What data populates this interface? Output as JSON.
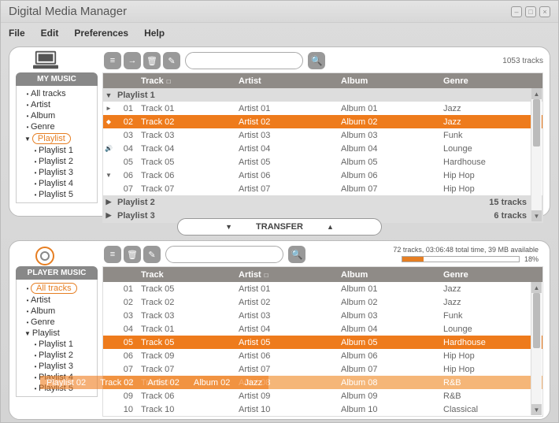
{
  "window": {
    "title": "Digital Media Manager"
  },
  "menu": {
    "file": "File",
    "edit": "Edit",
    "preferences": "Preferences",
    "help": "Help"
  },
  "top_panel": {
    "sidebar_title": "MY MUSIC",
    "track_count": "1053 tracks",
    "sidebar": [
      {
        "label": "All tracks",
        "indent": false,
        "bullet": "•"
      },
      {
        "label": "Artist",
        "indent": false,
        "bullet": "•"
      },
      {
        "label": "Album",
        "indent": false,
        "bullet": "•"
      },
      {
        "label": "Genre",
        "indent": false,
        "bullet": "•"
      },
      {
        "label": "Playlist",
        "indent": false,
        "bullet": "▼",
        "selected": true
      },
      {
        "label": "Playlist 1",
        "indent": true,
        "bullet": "•"
      },
      {
        "label": "Playlist 2",
        "indent": true,
        "bullet": "•"
      },
      {
        "label": "Playlist 3",
        "indent": true,
        "bullet": "•"
      },
      {
        "label": "Playlist 4",
        "indent": true,
        "bullet": "•"
      },
      {
        "label": "Playlist 5",
        "indent": true,
        "bullet": "•"
      }
    ],
    "columns": {
      "track": "Track",
      "artist": "Artist",
      "album": "Album",
      "genre": "Genre"
    },
    "groups": [
      {
        "label": "Playlist 1",
        "expanded": true,
        "rows": [
          {
            "num": "01",
            "play": "►",
            "track": "Track 01",
            "artist": "Artist 01",
            "album": "Album 01",
            "genre": "Jazz"
          },
          {
            "num": "02",
            "play": "◆",
            "track": "Track 02",
            "artist": "Artist 02",
            "album": "Album 02",
            "genre": "Jazz",
            "selected": true
          },
          {
            "num": "03",
            "play": "",
            "track": "Track 03",
            "artist": "Artist 03",
            "album": "Album 03",
            "genre": "Funk"
          },
          {
            "num": "04",
            "play": "🔊",
            "track": "Track 04",
            "artist": "Artist 04",
            "album": "Album 04",
            "genre": "Lounge"
          },
          {
            "num": "05",
            "play": "",
            "track": "Track 05",
            "artist": "Artist 05",
            "album": "Album 05",
            "genre": "Hardhouse"
          },
          {
            "num": "06",
            "play": "▼",
            "track": "Track 06",
            "artist": "Artist 06",
            "album": "Album 06",
            "genre": "Hip Hop"
          },
          {
            "num": "07",
            "play": "",
            "track": "Track 07",
            "artist": "Artist 07",
            "album": "Album 07",
            "genre": "Hip Hop"
          }
        ]
      },
      {
        "label": "Playlist 2",
        "expanded": false,
        "info": "15 tracks"
      },
      {
        "label": "Playlist 3",
        "expanded": false,
        "info": "6 tracks"
      }
    ]
  },
  "transfer": {
    "label": "TRANSFER"
  },
  "bottom_panel": {
    "sidebar_title": "PLAYER MUSIC",
    "status": "72 tracks, 03:06:48 total time, 39 MB available",
    "progress_pct": "18%",
    "progress_value": 18,
    "sidebar": [
      {
        "label": "All tracks",
        "indent": false,
        "bullet": "•",
        "selected": true
      },
      {
        "label": "Artist",
        "indent": false,
        "bullet": "•"
      },
      {
        "label": "Album",
        "indent": false,
        "bullet": "•"
      },
      {
        "label": "Genre",
        "indent": false,
        "bullet": "•"
      },
      {
        "label": "Playlist",
        "indent": false,
        "bullet": "▼"
      },
      {
        "label": "Playlist 1",
        "indent": true,
        "bullet": "•"
      },
      {
        "label": "Playlist 2",
        "indent": true,
        "bullet": "•"
      },
      {
        "label": "Playlist 3",
        "indent": true,
        "bullet": "•"
      },
      {
        "label": "Playlist 4",
        "indent": true,
        "bullet": "•"
      },
      {
        "label": "Playlist 5",
        "indent": true,
        "bullet": "•"
      }
    ],
    "columns": {
      "track": "Track",
      "artist": "Artist",
      "album": "Album",
      "genre": "Genre"
    },
    "rows": [
      {
        "num": "01",
        "track": "Track 05",
        "artist": "Artist 01",
        "album": "Album 01",
        "genre": "Jazz"
      },
      {
        "num": "02",
        "track": "Track 02",
        "artist": "Artist 02",
        "album": "Album 02",
        "genre": "Jazz"
      },
      {
        "num": "03",
        "track": "Track 03",
        "artist": "Artist 03",
        "album": "Album 03",
        "genre": "Funk"
      },
      {
        "num": "04",
        "track": "Track 01",
        "artist": "Artist 04",
        "album": "Album 04",
        "genre": "Lounge"
      },
      {
        "num": "05",
        "track": "Track 05",
        "artist": "Artist 05",
        "album": "Album 05",
        "genre": "Hardhouse",
        "selected": true
      },
      {
        "num": "06",
        "track": "Track 09",
        "artist": "Artist 06",
        "album": "Album 06",
        "genre": "Hip Hop"
      },
      {
        "num": "07",
        "track": "Track 07",
        "artist": "Artist 07",
        "album": "Album 07",
        "genre": "Hip Hop"
      },
      {
        "num": "08",
        "track": "Track 08",
        "artist": "Artist 08",
        "album": "Album 08",
        "genre": "R&B",
        "drag": true,
        "ghost": {
          "num": "02",
          "track": "Track 02",
          "artist": "Artist 02",
          "album": "Album 02",
          "genre": "Jazz"
        }
      },
      {
        "num": "09",
        "track": "Track 06",
        "artist": "Artist 09",
        "album": "Album 09",
        "genre": "R&B"
      },
      {
        "num": "10",
        "track": "Track 10",
        "artist": "Artist 10",
        "album": "Album 10",
        "genre": "Classical"
      }
    ]
  }
}
